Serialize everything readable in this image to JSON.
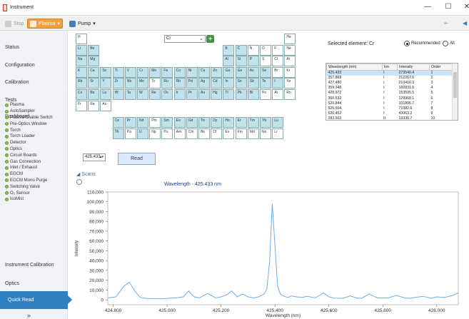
{
  "window": {
    "title": "Instrument",
    "controls": [
      "—",
      "☐",
      "✕"
    ]
  },
  "toolbar": {
    "stop": "Stop",
    "plasma": "Plasma",
    "pump": "Pump",
    "right_glyphs": [
      "⇤",
      "◀"
    ]
  },
  "sidebar": {
    "nav": [
      "Status",
      "Configuration",
      "Calibration",
      "Tests",
      "Dashboard",
      "Instrument Calibration",
      "Optics"
    ],
    "status_items": [
      "Plasma",
      "AutoSampler",
      "Plasma Enable Switch",
      "Pre-Optics Window",
      "Torch",
      "Torch Loader",
      "Detector",
      "Optics",
      "Circuit Boards",
      "Gas Connection",
      "Inlet / Exhaust",
      "EGCM",
      "EGCM Mono Purge",
      "Switching Valve",
      "O₂ Sensor",
      "IsoMist"
    ],
    "quick_read": "Quick Read",
    "bottom_glyph": "»"
  },
  "periodic_table": {
    "element_select": "Cr",
    "add_icon": "+",
    "rows": [
      [
        [
          "H",
          0
        ],
        [
          "He",
          0
        ]
      ],
      [
        [
          "Li",
          1
        ],
        [
          "Be",
          1
        ],
        [
          "B",
          1
        ],
        [
          "C",
          1
        ],
        [
          "N",
          0
        ],
        [
          "O",
          0
        ],
        [
          "F",
          0
        ],
        [
          "Ne",
          0
        ]
      ],
      [
        [
          "Na",
          1
        ],
        [
          "Mg",
          1
        ],
        [
          "Al",
          1
        ],
        [
          "Si",
          1
        ],
        [
          "P",
          1
        ],
        [
          "S",
          0
        ],
        [
          "Cl",
          0
        ],
        [
          "Ar",
          0
        ]
      ],
      [
        [
          "K",
          1
        ],
        [
          "Ca",
          1
        ],
        [
          "Sc",
          1
        ],
        [
          "Ti",
          1
        ],
        [
          "V",
          1
        ],
        [
          "Cr",
          1
        ],
        [
          "Mn",
          1
        ],
        [
          "Fe",
          1
        ],
        [
          "Co",
          1
        ],
        [
          "Ni",
          1
        ],
        [
          "Cu",
          1
        ],
        [
          "Zn",
          1
        ],
        [
          "Ga",
          1
        ],
        [
          "Ge",
          1
        ],
        [
          "As",
          1
        ],
        [
          "Se",
          1
        ],
        [
          "Br",
          0
        ],
        [
          "Kr",
          0
        ]
      ],
      [
        [
          "Rb",
          1
        ],
        [
          "Sr",
          1
        ],
        [
          "Y",
          1
        ],
        [
          "Zr",
          1
        ],
        [
          "Nb",
          1
        ],
        [
          "Mo",
          1
        ],
        [
          "Tc",
          0
        ],
        [
          "Ru",
          1
        ],
        [
          "Rh",
          1
        ],
        [
          "Pd",
          1
        ],
        [
          "Ag",
          1
        ],
        [
          "Cd",
          1
        ],
        [
          "In",
          1
        ],
        [
          "Sn",
          1
        ],
        [
          "Sb",
          1
        ],
        [
          "Te",
          1
        ],
        [
          "I",
          1
        ],
        [
          "Xe",
          0
        ]
      ],
      [
        [
          "Cs",
          1
        ],
        [
          "Ba",
          1
        ],
        [
          "La",
          1
        ],
        [
          "Hf",
          1
        ],
        [
          "Ta",
          1
        ],
        [
          "W",
          1
        ],
        [
          "Re",
          1
        ],
        [
          "Os",
          1
        ],
        [
          "Ir",
          1
        ],
        [
          "Pt",
          1
        ],
        [
          "Au",
          1
        ],
        [
          "Hg",
          1
        ],
        [
          "Tl",
          1
        ],
        [
          "Pb",
          1
        ],
        [
          "Bi",
          1
        ],
        [
          "Po",
          0
        ],
        [
          "At",
          0
        ],
        [
          "Rn",
          0
        ]
      ],
      [
        [
          "Fr",
          0
        ],
        [
          "Ra",
          0
        ],
        [
          "Ac",
          0
        ]
      ],
      [
        [
          "Ce",
          1
        ],
        [
          "Pr",
          1
        ],
        [
          "Nd",
          1
        ],
        [
          "Pm",
          0
        ],
        [
          "Sm",
          1
        ],
        [
          "Eu",
          1
        ],
        [
          "Gd",
          1
        ],
        [
          "Tb",
          1
        ],
        [
          "Dy",
          1
        ],
        [
          "Ho",
          1
        ],
        [
          "Er",
          1
        ],
        [
          "Tm",
          1
        ],
        [
          "Yb",
          1
        ],
        [
          "Lu",
          1
        ]
      ],
      [
        [
          "Th",
          1
        ],
        [
          "Pa",
          0
        ],
        [
          "U",
          1
        ],
        [
          "Np",
          0
        ],
        [
          "Pu",
          0
        ],
        [
          "Am",
          0
        ],
        [
          "Cm",
          0
        ],
        [
          "Bk",
          0
        ],
        [
          "Cf",
          0
        ],
        [
          "Es",
          0
        ],
        [
          "Fm",
          0
        ],
        [
          "Md",
          0
        ],
        [
          "No",
          0
        ],
        [
          "Lr",
          0
        ]
      ]
    ]
  },
  "wavelength_select": "425.433",
  "read_button": "Read",
  "selected_element": "Selected element: Cr",
  "radio": {
    "recommended": "Recommended",
    "all": "All",
    "selected": "Recommended"
  },
  "wl_table": {
    "headers": [
      "Wavelength (nm)",
      "Ion",
      "Intensity",
      "Order"
    ],
    "rows": [
      [
        "425.433",
        "I",
        "273540.4",
        "1"
      ],
      [
        "357.868",
        "I",
        "212267.6",
        "2"
      ],
      [
        "427.480",
        "I",
        "210416.3",
        "3"
      ],
      [
        "359.348",
        "I",
        "182831.0",
        "4"
      ],
      [
        "428.972",
        "I",
        "153595.5",
        "5"
      ],
      [
        "360.532",
        "I",
        "129968.1",
        "6"
      ],
      [
        "520.844",
        "I",
        "101895.7",
        "7"
      ],
      [
        "520.604",
        "I",
        "71082.6",
        "8"
      ],
      [
        "520.452",
        "I",
        "43063.2",
        "9"
      ],
      [
        "283.563",
        "II",
        "13330.7",
        "10"
      ]
    ]
  },
  "scans_label": "Scans",
  "chart_data": {
    "type": "line",
    "title": "Wavelength -  425.433 nm",
    "xlabel": "Wavelength (nm)",
    "ylabel": "Intensity",
    "xlim": [
      424.78,
      426.08
    ],
    "ylim": [
      -5000,
      110000
    ],
    "xticks": [
      "424.800",
      "425.000",
      "425.200",
      "425.400",
      "425.600",
      "425.800",
      "426.000"
    ],
    "yticks": [
      "0",
      "10,000",
      "20,000",
      "30,000",
      "40,000",
      "50,000",
      "60,000",
      "70,000",
      "80,000",
      "90,000",
      "100,000",
      "110,000"
    ],
    "color": "#6aaee8",
    "x": [
      424.78,
      424.81,
      424.84,
      424.86,
      424.88,
      424.9,
      424.92,
      424.95,
      424.98,
      425.0,
      425.03,
      425.06,
      425.08,
      425.1,
      425.12,
      425.15,
      425.18,
      425.2,
      425.22,
      425.24,
      425.26,
      425.28,
      425.3,
      425.32,
      425.34,
      425.36,
      425.37,
      425.38,
      425.39,
      425.4,
      425.41,
      425.42,
      425.43,
      425.44,
      425.45,
      425.46,
      425.48,
      425.5,
      425.52,
      425.55,
      425.58,
      425.6,
      425.62,
      425.65,
      425.68,
      425.7,
      425.72,
      425.75,
      425.78,
      425.8,
      425.82,
      425.85,
      425.88,
      425.9,
      425.92,
      425.95,
      425.98,
      426.0,
      426.03,
      426.06,
      426.08
    ],
    "y": [
      2000,
      3000,
      14000,
      18000,
      9000,
      2500,
      1500,
      1200,
      1000,
      1500,
      2000,
      3000,
      9000,
      3000,
      2000,
      6500,
      2000,
      3000,
      5000,
      9000,
      3000,
      6000,
      3000,
      2000,
      3000,
      6000,
      11000,
      38000,
      98000,
      55000,
      14000,
      6000,
      4000,
      3000,
      2500,
      4000,
      3000,
      2500,
      3500,
      2000,
      7000,
      3000,
      1800,
      1500,
      4000,
      2000,
      1500,
      6000,
      2000,
      1800,
      2000,
      4500,
      2000,
      1500,
      2500,
      3500,
      1500,
      3000,
      2500,
      4500,
      7000
    ]
  }
}
